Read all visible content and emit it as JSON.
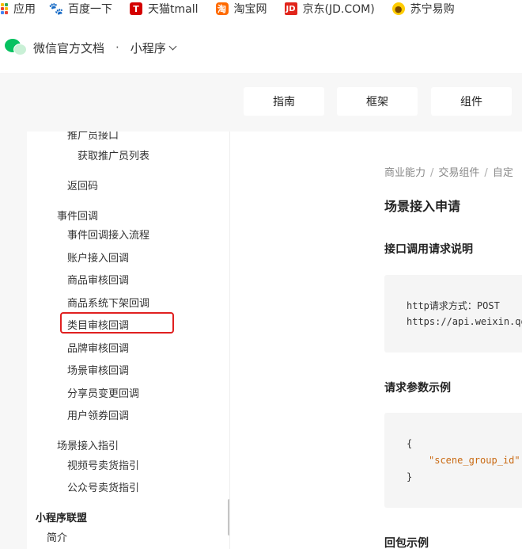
{
  "bookmarks": [
    {
      "label": "应用",
      "icon": "apps-grid-icon"
    },
    {
      "label": "百度一下",
      "icon": "baidu-icon"
    },
    {
      "label": "天猫tmall",
      "icon": "tmall-icon"
    },
    {
      "label": "淘宝网",
      "icon": "taobao-icon"
    },
    {
      "label": "京东(JD.COM)",
      "icon": "jd-icon"
    },
    {
      "label": "苏宁易购",
      "icon": "suning-icon"
    }
  ],
  "header": {
    "site_title": "微信官方文档",
    "separator": "·",
    "product": "小程序"
  },
  "nav": {
    "guide": "指南",
    "framework": "框架",
    "components": "组件"
  },
  "sidebar": {
    "items": [
      {
        "label": "推广员接口",
        "level": 3
      },
      {
        "label": "获取推广员列表",
        "level": 4
      },
      {
        "label": "返回码",
        "level": 3
      },
      {
        "label": "事件回调",
        "level": 2
      },
      {
        "label": "事件回调接入流程",
        "level": 3
      },
      {
        "label": "账户接入回调",
        "level": 3
      },
      {
        "label": "商品审核回调",
        "level": 3
      },
      {
        "label": "商品系统下架回调",
        "level": 3
      },
      {
        "label": "类目审核回调",
        "level": 3
      },
      {
        "label": "品牌审核回调",
        "level": 3
      },
      {
        "label": "场景审核回调",
        "level": 3
      },
      {
        "label": "分享员变更回调",
        "level": 3
      },
      {
        "label": "用户领券回调",
        "level": 3
      },
      {
        "label": "场景接入指引",
        "level": 2
      },
      {
        "label": "视频号卖货指引",
        "level": 3
      },
      {
        "label": "公众号卖货指引",
        "level": 3
      },
      {
        "label": "小程序联盟",
        "level": 1
      },
      {
        "label": "简介",
        "level": 2
      }
    ],
    "highlighted": "类目审核回调",
    "highlight_color": "#e02020"
  },
  "main": {
    "breadcrumb": [
      "商业能力",
      "交易组件",
      "自定"
    ],
    "title": "场景接入申请",
    "section_request": "接口调用请求说明",
    "request_code": [
      "http请求方式：POST",
      "https://api.weixin.qq"
    ],
    "section_params": "请求参数示例",
    "params_code": [
      "{",
      "\"scene_group_id\"",
      "}"
    ],
    "section_response": "回包示例"
  },
  "colors": {
    "brand_green": "#07c160",
    "code_bg": "#f5f5f5",
    "string_color": "#c96a13"
  }
}
